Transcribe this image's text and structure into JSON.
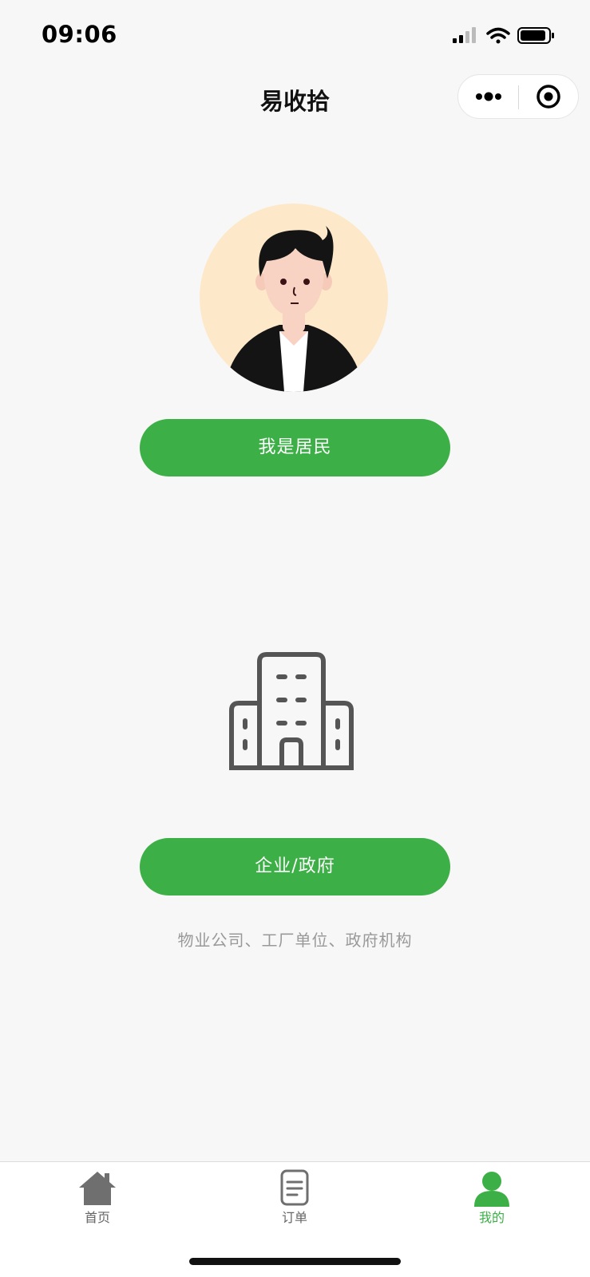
{
  "status_bar": {
    "time": "09:06",
    "icons": [
      "signal-icon",
      "wifi-icon",
      "battery-icon"
    ]
  },
  "nav": {
    "title": "易收拾",
    "more_icon": "more-dots-icon",
    "close_icon": "target-close-icon"
  },
  "resident": {
    "avatar_icon": "person-avatar-icon",
    "button_label": "我是居民"
  },
  "company": {
    "building_icon": "building-icon",
    "button_label": "企业/政府",
    "description": "物业公司、工厂单位、政府机构"
  },
  "tab_bar": {
    "items": [
      {
        "label": "首页",
        "icon": "home-icon",
        "active": false
      },
      {
        "label": "订单",
        "icon": "document-icon",
        "active": false
      },
      {
        "label": "我的",
        "icon": "user-icon",
        "active": true
      }
    ]
  },
  "colors": {
    "accent": "#3cb046",
    "background": "#f7f7f7",
    "avatar_bg": "#fde9c9",
    "icon_gray": "#555555"
  }
}
